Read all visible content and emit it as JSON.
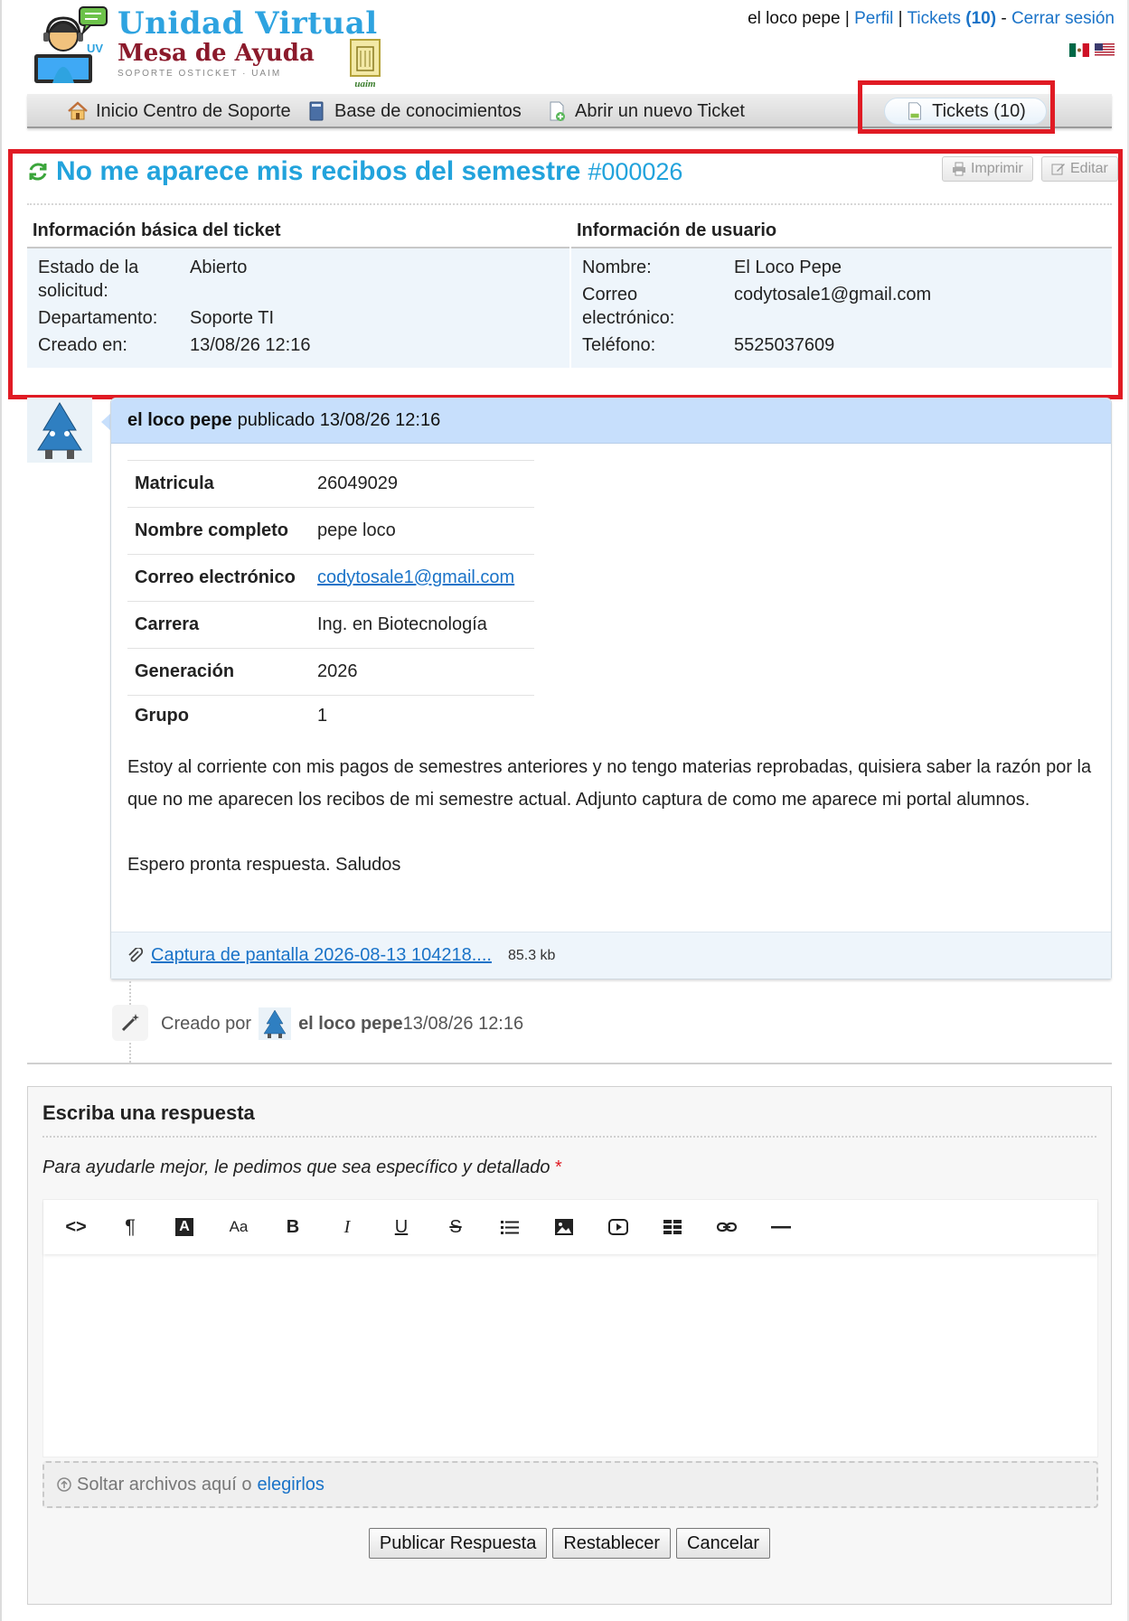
{
  "logo": {
    "title_line1": "Unidad Virtual",
    "title_line2": "Mesa de Ayuda",
    "subtitle": "SOPORTE OSTICKET · UAIM",
    "badge_text": "UV",
    "seal_text": "uaim"
  },
  "userbar": {
    "username": "el loco pepe",
    "sep1": "|",
    "profile": "Perfil",
    "sep2": "|",
    "tickets_label": "Tickets",
    "tickets_count": "(10)",
    "sep3": "-",
    "logout": "Cerrar sesión"
  },
  "nav": {
    "home": "Inicio Centro de Soporte",
    "kb": "Base de conocimientos",
    "new_ticket": "Abrir un nuevo Ticket",
    "tickets": "Tickets (10)"
  },
  "ticket": {
    "title": "No me aparece mis recibos del semestre",
    "number": "#000026",
    "print_label": "Imprimir",
    "edit_label": "Editar"
  },
  "basic_info": {
    "heading": "Información básica del ticket",
    "rows": [
      {
        "label": "Estado de la solicitud:",
        "value": "Abierto"
      },
      {
        "label": "Departamento:",
        "value": "Soporte TI"
      },
      {
        "label": "Creado en:",
        "value": "13/08/26 12:16"
      }
    ]
  },
  "user_info": {
    "heading": "Información de usuario",
    "rows": [
      {
        "label": "Nombre:",
        "value": "El Loco Pepe"
      },
      {
        "label": "Correo electrónico:",
        "value": "codytosale1@gmail.com"
      },
      {
        "label": "Teléfono:",
        "value": "5525037609"
      }
    ]
  },
  "thread": {
    "author": "el loco pepe",
    "posted": "publicado 13/08/26 12:16",
    "fields": [
      {
        "label": "Matricula",
        "value": "26049029"
      },
      {
        "label": "Nombre completo",
        "value": "pepe loco"
      },
      {
        "label": "Correo electrónico",
        "value": "codytosale1@gmail.com"
      },
      {
        "label": "Carrera",
        "value": "Ing. en Biotecnología"
      },
      {
        "label": "Generación",
        "value": "2026"
      },
      {
        "label": "Grupo",
        "value": "1"
      }
    ],
    "body_p1": "Estoy al corriente con mis pagos de semestres anteriores y no tengo materias reprobadas, quisiera saber la razón por la que no me aparecen los recibos de mi semestre actual. Adjunto captura de como me aparece mi portal alumnos.",
    "body_p2": "Espero pronta respuesta. Saludos",
    "attachment_name": "Captura de pantalla 2026-08-13 104218....",
    "attachment_size": "85.3 kb"
  },
  "event": {
    "created_by": "Creado por",
    "author": "el loco pepe",
    "time": "13/08/26 12:16"
  },
  "reply": {
    "title": "Escriba una respuesta",
    "hint": "Para ayudarle mejor, le pedimos que sea específico y detallado",
    "required_mark": "*",
    "drop_text": "Soltar archivos aquí o",
    "drop_link": "elegirlos",
    "toolbar": {
      "code": "<>",
      "paragraph": "¶",
      "color": "A",
      "font_size": "Aa",
      "bold": "B",
      "italic": "I",
      "underline": "U",
      "strike": "S"
    },
    "submit": "Publicar Respuesta",
    "reset": "Restablecer",
    "cancel": "Cancelar"
  },
  "colors": {
    "accent": "#22a3dc",
    "link": "#1a73c8",
    "highlight_box": "#e01b24",
    "thread_header": "#c7dffc",
    "info_background": "#eef5fb"
  }
}
